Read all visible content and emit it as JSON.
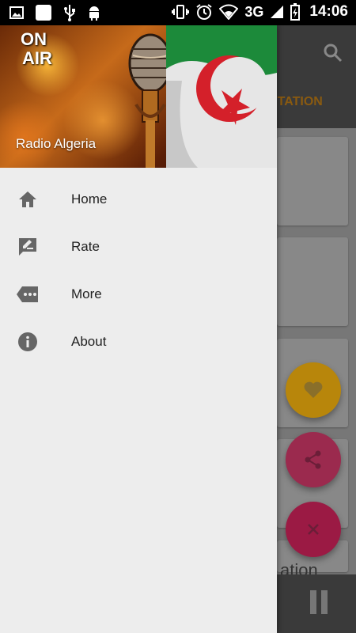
{
  "status_bar": {
    "time": "14:06",
    "network": "3G",
    "icons": [
      "image-icon",
      "blank-app-icon",
      "usb-icon",
      "android-icon",
      "vibrate-icon",
      "alarm-icon",
      "wifi-icon",
      "signal-icon",
      "battery-icon"
    ]
  },
  "drawer": {
    "header": {
      "badge_line1": "ON",
      "badge_line2": "AIR",
      "title": "Radio Algeria"
    },
    "items": [
      {
        "label": "Home",
        "icon": "home-icon"
      },
      {
        "label": "Rate",
        "icon": "rate-icon"
      },
      {
        "label": "More",
        "icon": "more-icon"
      },
      {
        "label": "About",
        "icon": "info-icon"
      }
    ]
  },
  "background_app": {
    "tab_label": "STATION",
    "partial_text": "ation",
    "fabs": [
      {
        "name": "favorite",
        "icon": "heart-icon",
        "color": "#d4a017"
      },
      {
        "name": "share",
        "icon": "share-icon",
        "color": "#c2185b"
      },
      {
        "name": "close",
        "icon": "close-icon",
        "color": "#c2185b"
      }
    ],
    "player_icon": "pause-icon"
  },
  "colors": {
    "drawer_bg": "#ededed",
    "icon_gray": "#666666",
    "scrim": "#777777"
  }
}
